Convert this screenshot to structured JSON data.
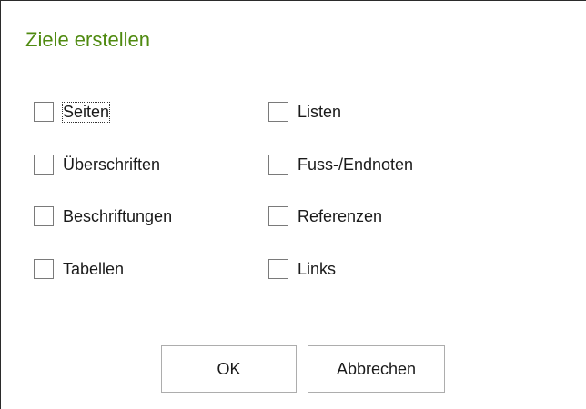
{
  "dialog": {
    "title": "Ziele erstellen",
    "title_color": "#4f8a10",
    "focused_option": "Seiten",
    "checkboxes": {
      "seiten": {
        "label": "Seiten",
        "checked": false
      },
      "ueberschriften": {
        "label": "Überschriften",
        "checked": false
      },
      "beschriftungen": {
        "label": "Beschriftungen",
        "checked": false
      },
      "tabellen": {
        "label": "Tabellen",
        "checked": false
      },
      "listen": {
        "label": "Listen",
        "checked": false
      },
      "fussnoten": {
        "label": "Fuss-/Endnoten",
        "checked": false
      },
      "referenzen": {
        "label": "Referenzen",
        "checked": false
      },
      "links": {
        "label": "Links",
        "checked": false
      }
    },
    "buttons": {
      "ok": "OK",
      "cancel": "Abbrechen"
    }
  }
}
